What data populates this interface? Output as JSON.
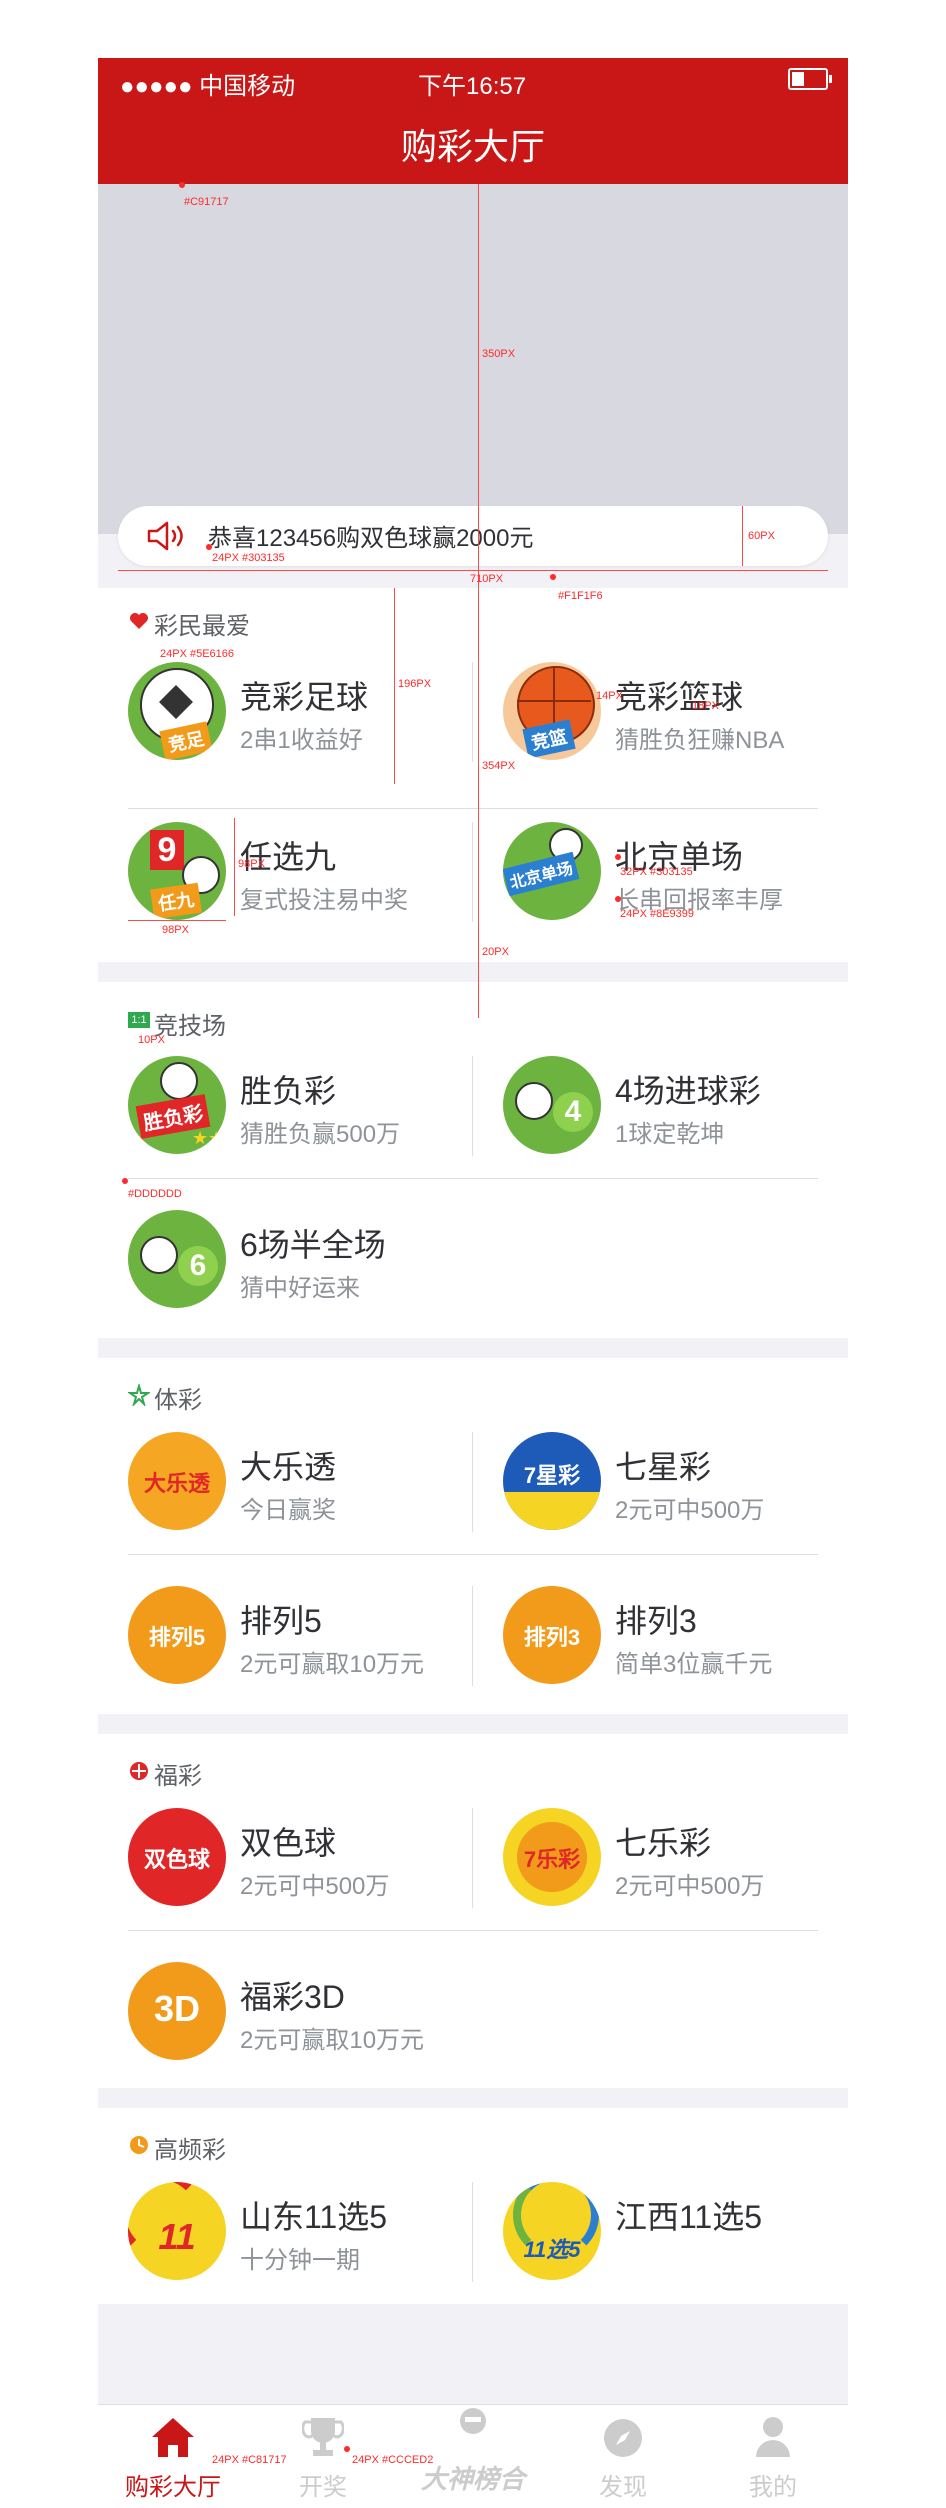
{
  "status": {
    "carrier": "●●●●● 中国移动",
    "time": "下午16:57"
  },
  "header": {
    "title": "购彩大厅"
  },
  "notice": {
    "text": "恭喜123456购双色球赢2000元"
  },
  "sections": [
    {
      "title": "彩民最爱",
      "items": [
        {
          "name": "竞彩足球",
          "desc": "2串1收益好",
          "logo_text": "竞足"
        },
        {
          "name": "竞彩篮球",
          "desc": "猜胜负狂赚NBA",
          "logo_text": "竞篮"
        },
        {
          "name": "任选九",
          "desc": "复式投注易中奖",
          "logo_text": "任九"
        },
        {
          "name": "北京单场",
          "desc": "长串回报率丰厚",
          "logo_text": "北京单场"
        }
      ]
    },
    {
      "title": "竞技场",
      "items": [
        {
          "name": "胜负彩",
          "desc": "猜胜负赢500万",
          "logo_text": "胜负彩"
        },
        {
          "name": "4场进球彩",
          "desc": "1球定乾坤",
          "logo_text": "4"
        },
        {
          "name": "6场半全场",
          "desc": "猜中好运来",
          "logo_text": "6"
        }
      ]
    },
    {
      "title": "体彩",
      "items": [
        {
          "name": "大乐透",
          "desc": "今日赢奖",
          "logo_text": "大乐透"
        },
        {
          "name": "七星彩",
          "desc": "2元可中500万",
          "logo_text": "7星彩"
        },
        {
          "name": "排列5",
          "desc": "2元可赢取10万元",
          "logo_text": "排列5"
        },
        {
          "name": "排列3",
          "desc": "简单3位赢千元",
          "logo_text": "排列3"
        }
      ]
    },
    {
      "title": "福彩",
      "items": [
        {
          "name": "双色球",
          "desc": "2元可中500万",
          "logo_text": "双色球"
        },
        {
          "name": "七乐彩",
          "desc": "2元可中500万",
          "logo_text": "7乐彩"
        },
        {
          "name": "福彩3D",
          "desc": "2元可赢取10万元",
          "logo_text": "3D"
        }
      ]
    },
    {
      "title": "高频彩",
      "items": [
        {
          "name": "山东11选5",
          "desc": "十分钟一期",
          "logo_text": "11"
        },
        {
          "name": "江西11选5",
          "desc": "",
          "logo_text": "11选5"
        }
      ]
    }
  ],
  "tabs": [
    {
      "label": "购彩大厅",
      "icon": "home-icon",
      "active": true
    },
    {
      "label": "开奖",
      "icon": "trophy-icon",
      "active": false
    },
    {
      "label": "大神榜合",
      "icon": "master-icon",
      "active": false
    },
    {
      "label": "发现",
      "icon": "compass-icon",
      "active": false
    },
    {
      "label": "我的",
      "icon": "user-icon",
      "active": false
    }
  ],
  "annotations": {
    "header_color": "#C91717",
    "banner_height": "350PX",
    "notice_height": "60PX",
    "notice_text_spec": "24PX #303135",
    "notice_width": "710PX",
    "bg_color": "#F1F1F6",
    "section_title_spec": "24PX #5E6166",
    "item_height": "196PX",
    "block_height": "354PX",
    "name_gap": "14PX",
    "name_desc_gap": "18PX",
    "logo_size": "98PX",
    "logo_width": "98PX",
    "name_spec": "32PX #303135",
    "desc_spec": "24PX #8E9399",
    "section_gap": "20PX",
    "icon_gap": "10PX",
    "divider_color": "#DDDDDD",
    "tab_active_spec": "24PX #C81717",
    "tab_inactive_spec": "24PX #CCCED2"
  },
  "colors": {
    "brand": "#c91717",
    "bg": "#f1f1f6",
    "text": "#303135",
    "subtext": "#8e9399",
    "divider": "#dddddd"
  }
}
